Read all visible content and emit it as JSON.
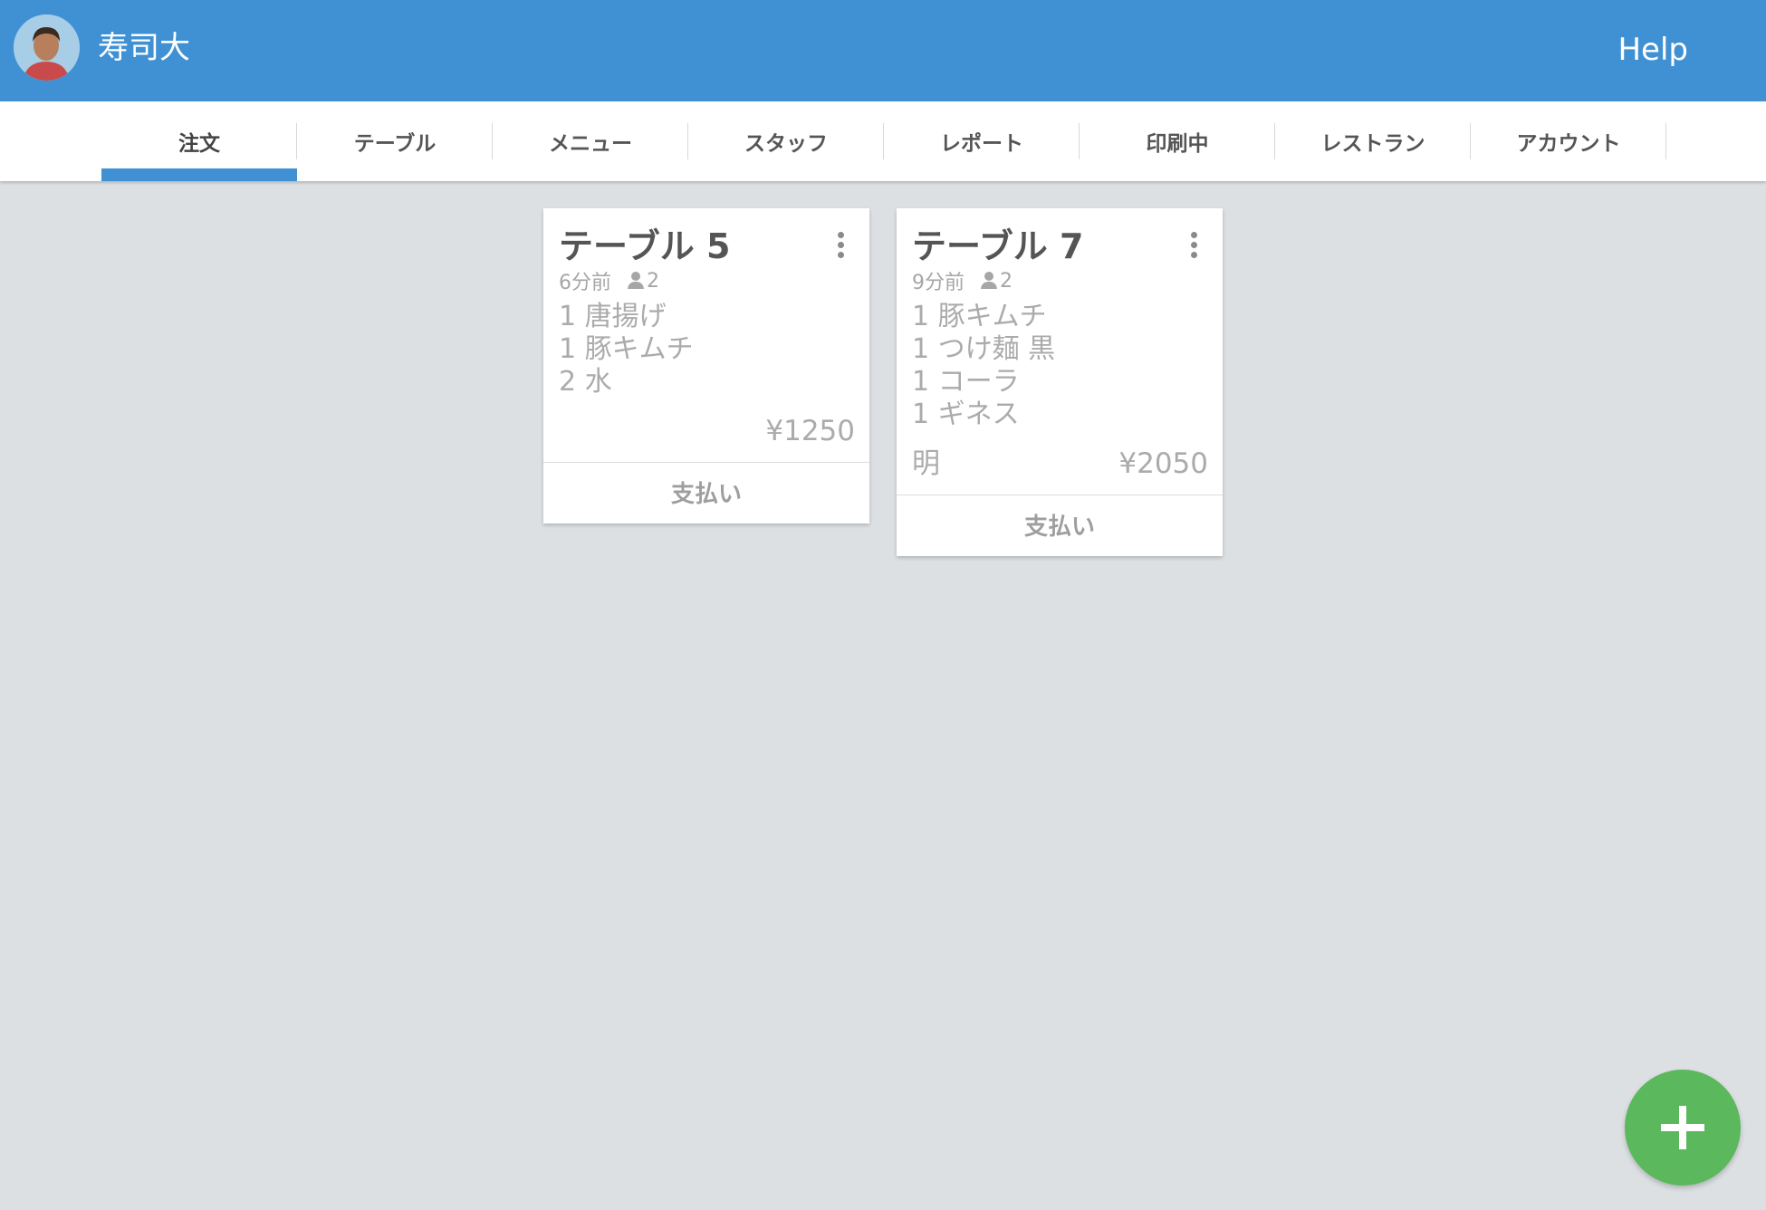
{
  "header": {
    "restaurant_name": "寿司大",
    "help_label": "Help",
    "color": "#3f91d3"
  },
  "tabs": [
    {
      "label": "注文",
      "active": true
    },
    {
      "label": "テーブル",
      "active": false
    },
    {
      "label": "メニュー",
      "active": false
    },
    {
      "label": "スタッフ",
      "active": false
    },
    {
      "label": "レポート",
      "active": false
    },
    {
      "label": "印刷中",
      "active": false
    },
    {
      "label": "レストラン",
      "active": false
    },
    {
      "label": "アカウント",
      "active": false
    }
  ],
  "orders": [
    {
      "title": "テーブル 5",
      "time_ago": "6分前",
      "guests": "2",
      "items": [
        "1 唐揚げ",
        "1 豚キムチ",
        "2 水"
      ],
      "note": "",
      "total": "¥1250",
      "pay_label": "支払い"
    },
    {
      "title": "テーブル 7",
      "time_ago": "9分前",
      "guests": "2",
      "items": [
        "1 豚キムチ",
        "1 つけ麺 黒",
        "1 コーラ",
        "1 ギネス"
      ],
      "note": "明",
      "total": "¥2050",
      "pay_label": "支払い"
    }
  ],
  "icons": {
    "menu": "kebab-icon",
    "guests": "person-icon",
    "add": "plus-icon"
  },
  "colors": {
    "accent": "#3f91d3",
    "fab": "#5cb85c",
    "background": "#dce0e3"
  }
}
